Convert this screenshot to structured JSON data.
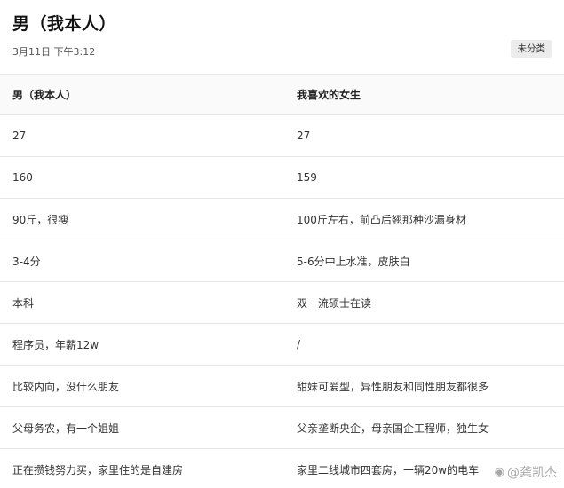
{
  "title": "男（我本人）",
  "date": "3月11日 下午3:12",
  "tag": "未分类",
  "table": {
    "headers": [
      "男（我本人）",
      "我喜欢的女生"
    ],
    "rows": [
      [
        "27",
        "27"
      ],
      [
        "160",
        "159"
      ],
      [
        "90斤，很瘦",
        "100斤左右，前凸后翘那种沙漏身材"
      ],
      [
        "3-4分",
        "5-6分中上水准，皮肤白"
      ],
      [
        "本科",
        "双一流硕士在读"
      ],
      [
        "程序员，年薪12w",
        "/"
      ],
      [
        "比较内向，没什么朋友",
        "甜妹可爱型，异性朋友和同性朋友都很多"
      ],
      [
        "父母务农，有一个姐姐",
        "父亲垄断央企，母亲国企工程师，独生女"
      ],
      [
        "正在攒钱努力买，家里住的是自建房",
        "家里二线城市四套房，一辆20w的电车"
      ]
    ]
  },
  "watermark": {
    "icon": "weibo-icon",
    "text": "@龚凯杰"
  }
}
